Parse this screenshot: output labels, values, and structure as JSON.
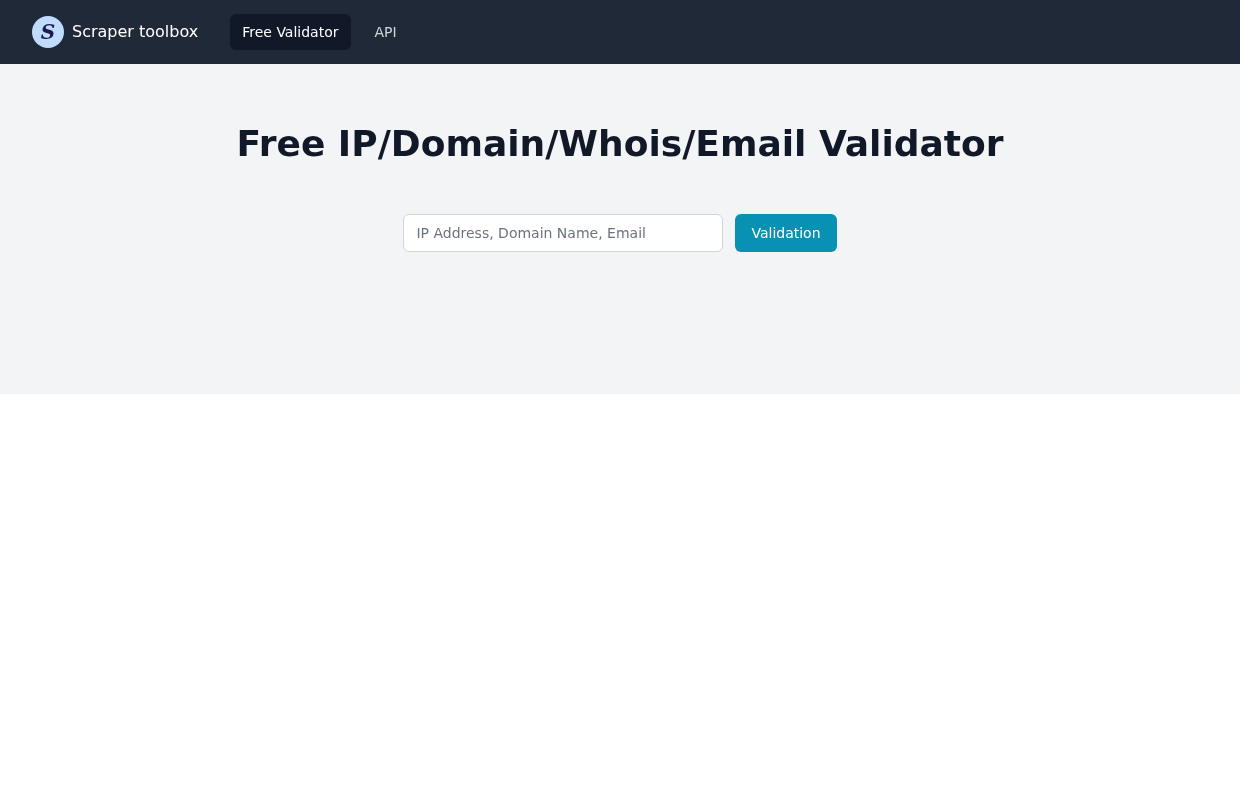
{
  "navbar": {
    "logo": {
      "letter": "S"
    },
    "brand": "Scraper toolbox",
    "links": [
      {
        "label": "Free Validator",
        "selected": true
      },
      {
        "label": "API",
        "selected": false
      }
    ]
  },
  "hero": {
    "title": "Free IP/Domain/Whois/Email Validator",
    "search": {
      "placeholder": "IP Address, Domain Name, Email"
    },
    "button": "Validation"
  }
}
